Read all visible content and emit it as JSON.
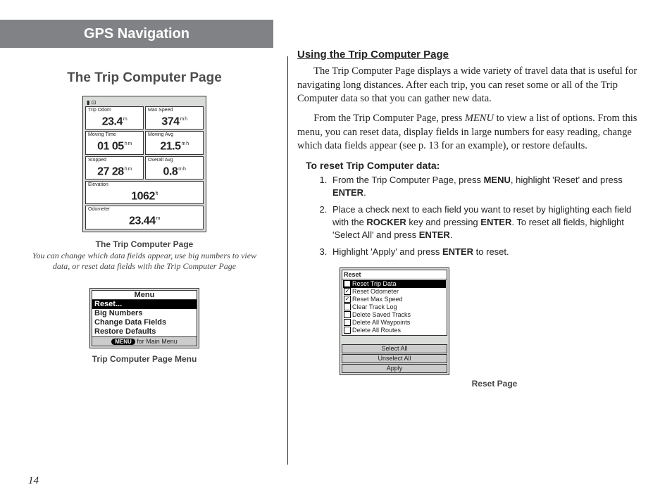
{
  "header": {
    "title": "GPS Navigation"
  },
  "page_number": "14",
  "left": {
    "title": "The Trip Computer Page",
    "device": {
      "fields": {
        "trip_odom": {
          "label": "Trip Odom",
          "value": "23.4",
          "unit": "m"
        },
        "max_speed": {
          "label": "Max Speed",
          "value": "374",
          "unit": "m h"
        },
        "moving_time": {
          "label": "Moving Time",
          "value": "01 05",
          "unit": "h m"
        },
        "moving_avg": {
          "label": "Moving Avg",
          "value": "21.5",
          "unit": "m h"
        },
        "stopped": {
          "label": "Stopped",
          "value": "27 28",
          "unit": "h m"
        },
        "overall_avg": {
          "label": "Overall Avg",
          "value": "0.8",
          "unit": "m h"
        },
        "elevation": {
          "label": "Elevation",
          "value": "1062",
          "unit": "ft"
        },
        "odometer": {
          "label": "Odometer",
          "value": "23.44",
          "unit": "m"
        }
      }
    },
    "caption1_title": "The Trip Computer Page",
    "caption1_desc": "You can change which data fields appear, use big numbers to view data, or reset data fields with the Trip Computer Page",
    "menu": {
      "title": "Menu",
      "items": [
        "Reset...",
        "Big Numbers",
        "Change Data Fields",
        "Restore Defaults"
      ],
      "selected_index": 0,
      "footer_btn": "MENU",
      "footer_text": "for Main Menu"
    },
    "caption2": "Trip Computer Page Menu"
  },
  "right": {
    "subhead": "Using the Trip Computer Page",
    "para1_a": "The Trip Computer Page displays a wide variety of travel data that is useful for navigating long distances. After each trip, you can reset some or all of the Trip Computer data so that you can gather new data.",
    "para2_pre": "From the Trip Computer Page, press ",
    "para2_menu": "MENU",
    "para2_post": " to view a list of options. From this menu, you can reset data, display fields in large numbers for easy reading, change which data fields appear (see p. 13 for an example), or restore defaults.",
    "steps_title": "To reset Trip Computer data:",
    "step1_a": "From the Trip Computer Page, press ",
    "step1_b": "MENU",
    "step1_c": ", highlight 'Reset' and press ",
    "step1_d": "ENTER",
    "step1_e": ".",
    "step2_a": "Place a check next to each field you want to reset by higlighting each field with the ",
    "step2_b": "ROCKER",
    "step2_c": " key and pressing ",
    "step2_d": "ENTER",
    "step2_e": ". To reset all fields, highlight 'Select All' and press ",
    "step2_f": "ENTER",
    "step2_g": ".",
    "step3_a": "Highlight 'Apply' and press ",
    "step3_b": "ENTER",
    "step3_c": " to reset.",
    "reset_screen": {
      "title": "Reset",
      "rows": [
        {
          "label": "Reset Trip Data",
          "checked": false,
          "selected": true
        },
        {
          "label": "Reset Odometer",
          "checked": true,
          "selected": false
        },
        {
          "label": "Reset Max Speed",
          "checked": true,
          "selected": false
        },
        {
          "label": "Clear Track Log",
          "checked": false,
          "selected": false
        },
        {
          "label": "Delete Saved Tracks",
          "checked": false,
          "selected": false
        },
        {
          "label": "Delete All Waypoints",
          "checked": false,
          "selected": false
        },
        {
          "label": "Delete All Routes",
          "checked": false,
          "selected": false
        }
      ],
      "buttons": [
        "Select All",
        "Unselect All",
        "Apply"
      ]
    },
    "reset_caption": "Reset Page"
  }
}
